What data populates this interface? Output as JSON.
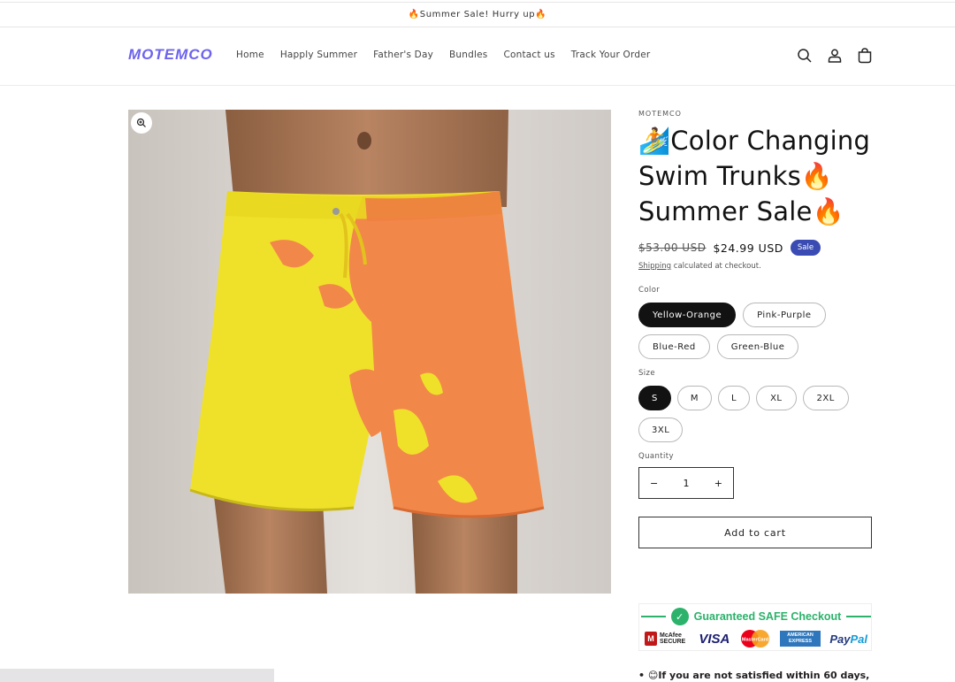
{
  "announcement": "🔥Summer Sale! Hurry up🔥",
  "header": {
    "logo": "MOTEMCO",
    "nav": [
      "Home",
      "Happly Summer",
      "Father's Day",
      "Bundles",
      "Contact us",
      "Track Your Order"
    ],
    "icons": [
      "search-icon",
      "account-icon",
      "cart-icon"
    ]
  },
  "product": {
    "vendor": "MOTEMCO",
    "title": "🏄Color Changing Swim Trunks🔥 Summer Sale🔥",
    "old_price": "$53.00 USD",
    "price": "$24.99 USD",
    "badge": "Sale",
    "shipping_link": "Shipping",
    "shipping_text": " calculated at checkout.",
    "color_label": "Color",
    "colors": [
      "Yellow-Orange",
      "Pink-Purple",
      "Blue-Red",
      "Green-Blue"
    ],
    "selected_color": "Yellow-Orange",
    "size_label": "Size",
    "sizes": [
      "S",
      "M",
      "L",
      "XL",
      "2XL",
      "3XL"
    ],
    "selected_size": "S",
    "quantity_label": "Quantity",
    "quantity": "1",
    "minus": "−",
    "plus": "+",
    "add_to_cart": "Add to cart"
  },
  "trust": {
    "title": "Guaranteed SAFE Checkout",
    "mcafee": "McAfee SECURE",
    "visa": "VISA",
    "mastercard": "MasterCard",
    "amex": "AMERICAN EXPRESS",
    "paypal_a": "Pay",
    "paypal_b": "Pal"
  },
  "guarantee_text": "• 😊If you are not satisfied within 60 days,"
}
